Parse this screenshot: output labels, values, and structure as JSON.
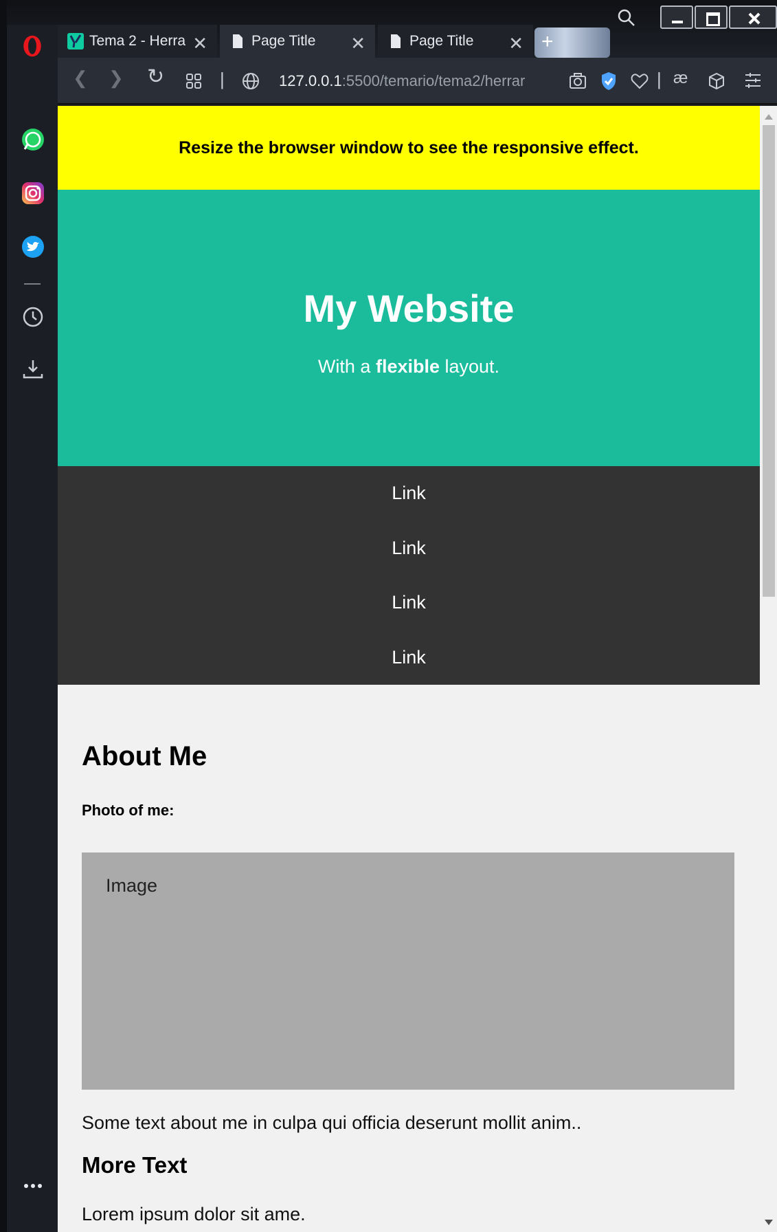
{
  "browser": {
    "tabs": [
      {
        "label": "Tema 2 - Herra"
      },
      {
        "label": "Page Title"
      },
      {
        "label": "Page Title"
      }
    ],
    "address": {
      "host": "127.0.0.1",
      "path": ":5500/temario/tema2/herrar"
    }
  },
  "page": {
    "notice": "Resize the browser window to see the responsive effect.",
    "header": {
      "title": "My Website",
      "subtitle_pre": "With a ",
      "subtitle_bold": "flexible",
      "subtitle_post": " layout."
    },
    "nav": [
      "Link",
      "Link",
      "Link",
      "Link"
    ],
    "main": {
      "heading": "About Me",
      "photo_label": "Photo of me:",
      "image_placeholder": "Image",
      "about_text": "Some text about me in culpa qui officia deserunt mollit anim..",
      "more_heading": "More Text",
      "lorem": "Lorem ipsum dolor sit ame."
    }
  },
  "colors": {
    "notice_bg": "#ffff00",
    "header_bg": "#1abc9c",
    "nav_bg": "#333333",
    "image_bg": "#aaaaaa"
  },
  "icons": [
    "opera-logo",
    "whatsapp-icon",
    "instagram-icon",
    "twitter-icon",
    "history-icon",
    "download-icon",
    "more-icon"
  ]
}
